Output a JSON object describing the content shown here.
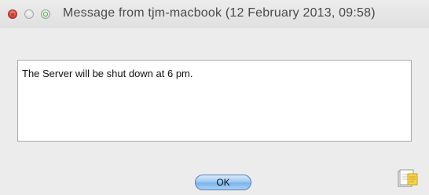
{
  "window": {
    "title": "Message from tjm-macbook (12 February 2013, 09:58)"
  },
  "message": {
    "text": "The Server will be shut down at 6 pm."
  },
  "buttons": {
    "ok_label": "OK"
  },
  "icons": {
    "close": "close-button-icon",
    "minimize": "minimize-button-icon",
    "zoom": "zoom-button-icon",
    "notes": "notes-icon"
  },
  "colors": {
    "window_bg": "#ececec",
    "close_red": "#e0443a",
    "button_blue": "#7ab4ec"
  }
}
